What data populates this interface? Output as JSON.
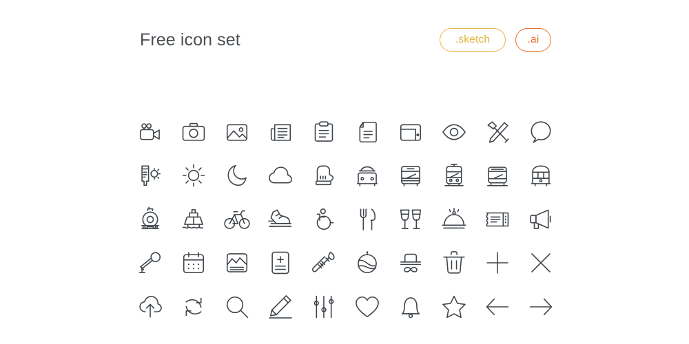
{
  "header": {
    "title": "Free icon set",
    "badges": [
      {
        "label": ".sketch",
        "name": "badge-sketch",
        "color": "#e3b63f"
      },
      {
        "label": ".ai",
        "name": "badge-ai",
        "color": "#e8712e"
      }
    ]
  },
  "theme": {
    "background": "#ffffff",
    "title_color": "#4a4f54",
    "icon_stroke": "#3f454b",
    "sketch_accent": "#e3b63f",
    "ai_accent": "#e8712e"
  },
  "grid": {
    "columns": 10,
    "rows": 5,
    "icons": [
      "video-camera-icon",
      "camera-icon",
      "image-icon",
      "newspaper-icon",
      "clipboard-icon",
      "document-icon",
      "wallet-icon",
      "eye-icon",
      "tools-hammer-chisel-icon",
      "speech-bubble-icon",
      "sunscreen-tube-icon",
      "sun-icon",
      "moon-icon",
      "cloud-icon",
      "mitten-glove-icon",
      "taxi-icon",
      "bus-icon",
      "tram-icon",
      "train-icon",
      "monorail-icon",
      "locomotive-icon",
      "ship-icon",
      "bicycle-icon",
      "sneaker-icon",
      "wheelchair-icon",
      "fork-knife-icon",
      "wine-glasses-icon",
      "food-cloche-icon",
      "ticket-icon",
      "megaphone-icon",
      "microphone-icon",
      "calendar-icon",
      "photo-card-icon",
      "plus-minus-document-icon",
      "baby-bottle-icon",
      "cap-hat-icon",
      "hat-mustache-icon",
      "trash-icon",
      "plus-icon",
      "close-icon",
      "cloud-upload-icon",
      "refresh-sync-icon",
      "search-icon",
      "pencil-edit-icon",
      "sliders-settings-icon",
      "heart-icon",
      "bell-icon",
      "star-icon",
      "arrow-left-icon",
      "arrow-right-icon"
    ]
  }
}
